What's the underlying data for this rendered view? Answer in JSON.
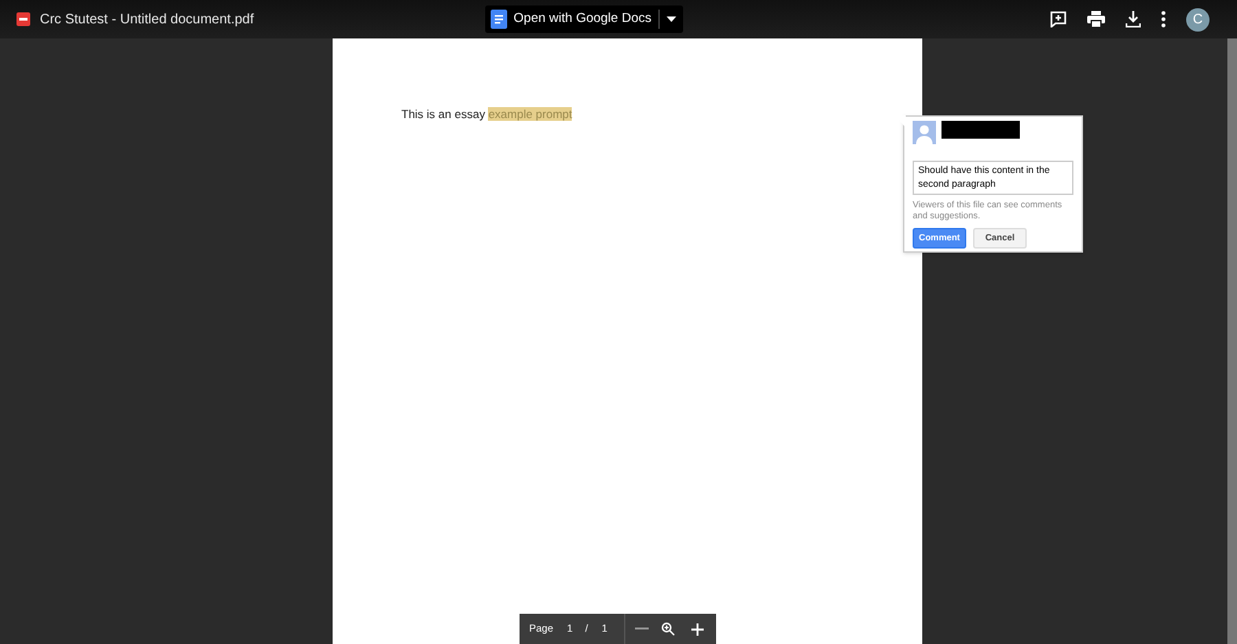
{
  "title": "Crc Stutest - Untitled document.pdf",
  "open_with": {
    "label": "Open with Google Docs"
  },
  "avatar": {
    "initial": "C"
  },
  "document": {
    "text": "This is an essay",
    "highlight": "example prompt"
  },
  "comment_box": {
    "value": "Should have this content in the second paragraph",
    "notice": "Viewers of this file can see comments and suggestions.",
    "buttons": [
      {
        "label": "Comment",
        "kind": "primary"
      },
      {
        "label": "Cancel",
        "kind": "secondary"
      }
    ]
  },
  "page_controls": {
    "label": "Page",
    "current": "1",
    "separator": "/",
    "total": "1"
  }
}
